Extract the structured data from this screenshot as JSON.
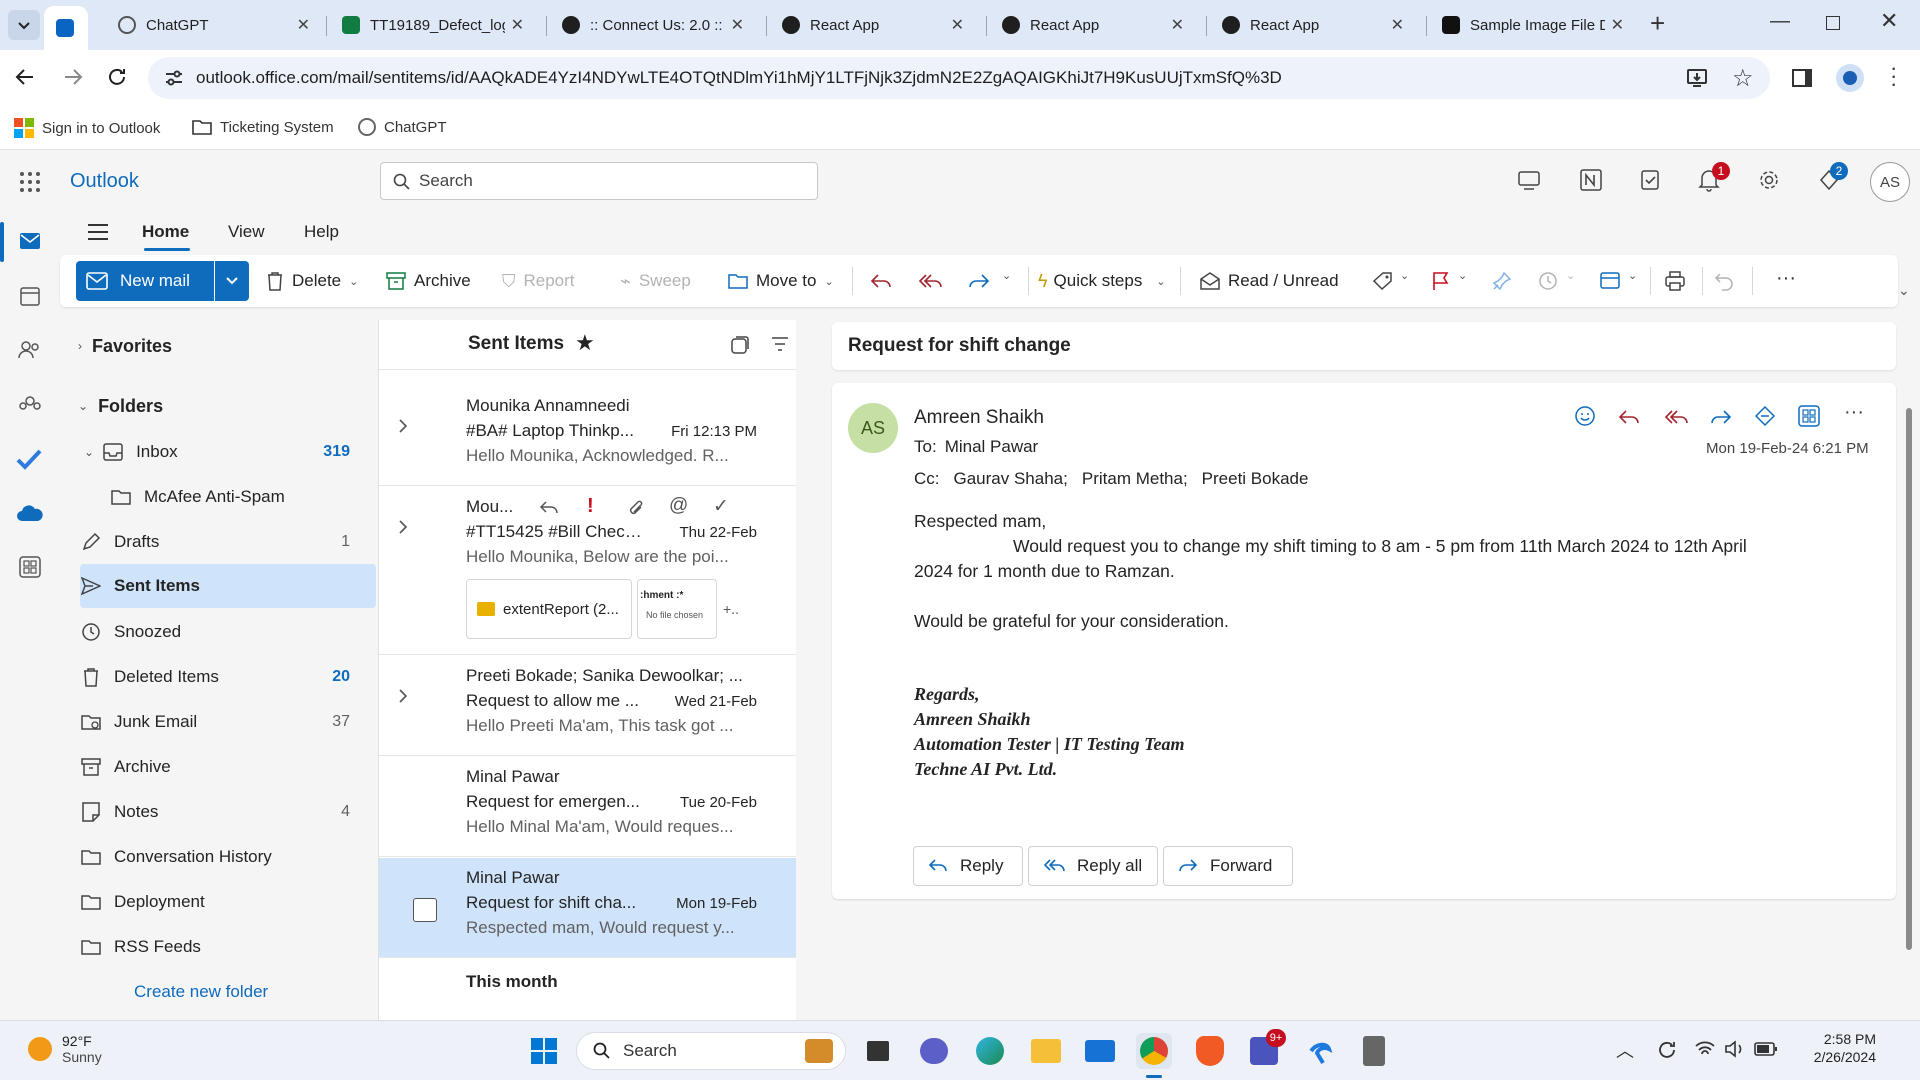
{
  "browser": {
    "tabs": [
      {
        "title": "ChatGPT",
        "active": false
      },
      {
        "title": "TT19189_Defect_log",
        "active": false
      },
      {
        "title": ":: Connect Us: 2.0 ::",
        "active": false
      },
      {
        "title": "React App",
        "active": false
      },
      {
        "title": "React App",
        "active": false
      },
      {
        "title": "React App",
        "active": false
      },
      {
        "title": "Sample Image File D",
        "active": false
      }
    ],
    "url": "outlook.office.com/mail/sentitems/id/AAQkADE4YzI4NDYwLTE4OTQtNDlmYi1hMjY1LTFjNjk3ZjdmN2E2ZgAQAIGKhiJt7H9KusUUjTxmSfQ%3D",
    "bookmarks": [
      "Sign in to Outlook",
      "Ticketing System",
      "ChatGPT"
    ]
  },
  "outlook": {
    "app_name": "Outlook",
    "search_placeholder": "Search",
    "notification_count": "1",
    "premium_count": "2",
    "user_initials": "AS",
    "menu_tabs": [
      "Home",
      "View",
      "Help"
    ],
    "ribbon": {
      "new_mail": "New mail",
      "delete": "Delete",
      "archive": "Archive",
      "report": "Report",
      "sweep": "Sweep",
      "move_to": "Move to",
      "quick_steps": "Quick steps",
      "read_unread": "Read / Unread"
    },
    "folders": {
      "favorites": "Favorites",
      "folders": "Folders",
      "items": [
        {
          "name": "Inbox",
          "count": "319"
        },
        {
          "name": "McAfee Anti-Spam",
          "count": ""
        },
        {
          "name": "Drafts",
          "count": "1"
        },
        {
          "name": "Sent Items",
          "count": ""
        },
        {
          "name": "Snoozed",
          "count": ""
        },
        {
          "name": "Deleted Items",
          "count": "20"
        },
        {
          "name": "Junk Email",
          "count": "37"
        },
        {
          "name": "Archive",
          "count": ""
        },
        {
          "name": "Notes",
          "count": "4"
        },
        {
          "name": "Conversation History",
          "count": ""
        },
        {
          "name": "Deployment",
          "count": ""
        },
        {
          "name": "RSS Feeds",
          "count": ""
        }
      ],
      "create_new": "Create new folder"
    },
    "list": {
      "title": "Sent Items",
      "messages": [
        {
          "from": "Mounika Annamneedi",
          "subject": "#BA# Laptop Thinkp...",
          "date": "Fri 12:13 PM",
          "preview": "Hello Mounika, Acknowledged. R..."
        },
        {
          "from": "Mou...",
          "subject": "#TT15425 #Bill Check...",
          "date": "Thu 22-Feb",
          "preview": "Hello Mounika, Below are the poi...",
          "attachment": "extentReport (2...",
          "attachment_thumb_line1": ":hment :*",
          "attachment_thumb_line2": "No file chosen",
          "more": "+.."
        },
        {
          "from": "Preeti Bokade; Sanika Dewoolkar; ...",
          "subject": "Request to allow me ...",
          "date": "Wed 21-Feb",
          "preview": "Hello Preeti Ma'am, This task got ..."
        },
        {
          "from": "Minal Pawar",
          "subject": "Request for emergen...",
          "date": "Tue 20-Feb",
          "preview": "Hello Minal Ma'am, Would reques..."
        },
        {
          "from": "Minal Pawar",
          "subject": "Request for shift cha...",
          "date": "Mon 19-Feb",
          "preview": "Respected mam, Would request y..."
        }
      ],
      "section": "This month"
    },
    "reading": {
      "subject": "Request for shift change",
      "sender_initials": "AS",
      "sender": "Amreen Shaikh",
      "to_label": "To:",
      "to": "Minal Pawar",
      "cc_label": "Cc:",
      "cc": [
        "Gaurav Shaha;",
        "Pritam Metha;",
        "Preeti Bokade"
      ],
      "datetime": "Mon 19-Feb-24 6:21 PM",
      "greeting": "Respected mam,",
      "body1": "Would request you to change my shift timing to 8 am - 5 pm from 11th March 2024 to 12th April",
      "body2": "2024 for 1 month due to Ramzan.",
      "body3": "Would be grateful for your consideration.",
      "sig": [
        "Regards,",
        "Amreen Shaikh",
        "Automation Tester | IT Testing Team",
        "Techne AI Pvt. Ltd."
      ],
      "reply": "Reply",
      "reply_all": "Reply all",
      "forward": "Forward"
    }
  },
  "taskbar": {
    "temp": "92°F",
    "weather": "Sunny",
    "search": "Search",
    "teams_badge": "9+",
    "time": "2:58 PM",
    "date": "2/26/2024"
  },
  "colors": {
    "accent": "#0f6cbd",
    "selected": "#cfe4fa",
    "chrome": "#dfe8f6"
  }
}
